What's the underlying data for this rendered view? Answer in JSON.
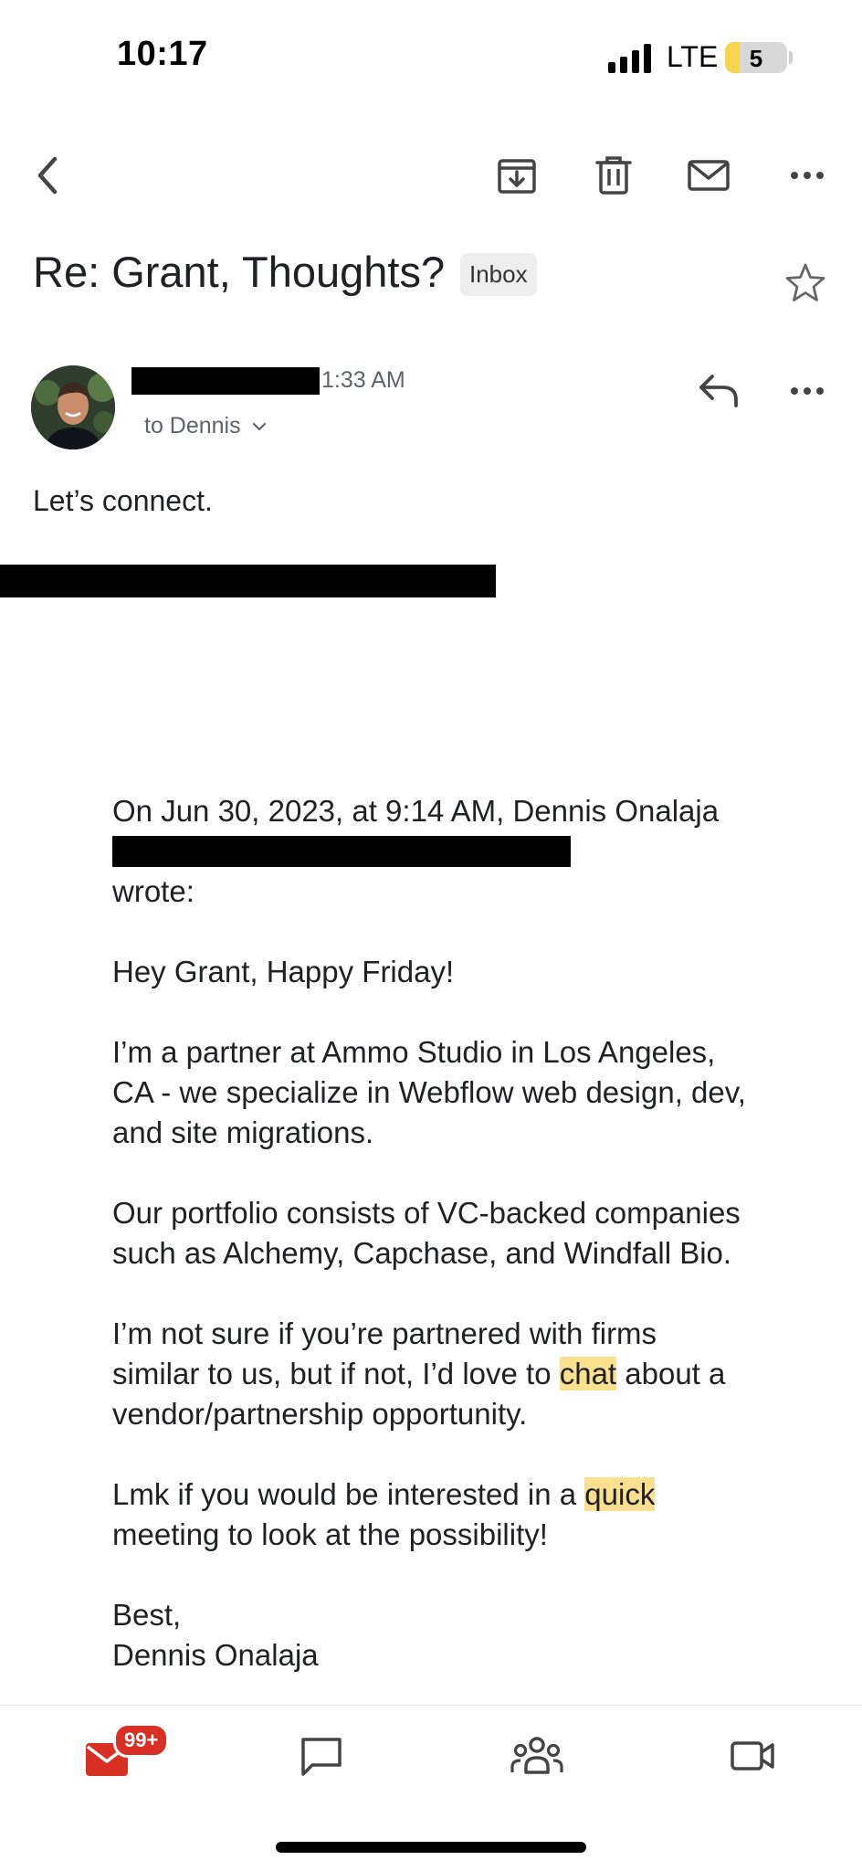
{
  "status_bar": {
    "time": "10:17",
    "network": "LTE",
    "battery": "5"
  },
  "toolbar": {
    "back_icon": "chevron-left-icon",
    "archive_icon": "archive-icon",
    "delete_icon": "trash-icon",
    "mark_unread_icon": "mail-icon",
    "more_icon": "more-horizontal-icon"
  },
  "email": {
    "subject": "Re: Grant, Thoughts?",
    "label": "Inbox",
    "sender": {
      "time": "1:33 AM",
      "recipients": "to Dennis"
    },
    "reply_text": "Let’s connect.",
    "quote": {
      "header_start": "On Jun 30, 2023, at 9:14 AM, Dennis Onalaja",
      "header_end": "wrote:",
      "greeting": "Hey Grant, Happy Friday!",
      "para1": "I’m a partner at Ammo Studio in Los Angeles, CA - we specialize in Webflow web design, dev, and site migrations.",
      "para2": "Our portfolio consists of VC-backed companies such as Alchemy, Capchase, and Windfall Bio.",
      "para3_before": "I’m not sure if you’re partnered with firms similar to us, but if not, I’d love to ",
      "para3_highlight": "chat",
      "para3_after": " about a vendor/partnership opportunity.",
      "para4_before": "Lmk if you would be interested in a ",
      "para4_highlight": "quick",
      "para4_after": " meeting to look at the possibility!",
      "signoff": "Best,",
      "signature": "Dennis Onalaja"
    }
  },
  "bottom_nav": {
    "mail_badge": "99+",
    "accent": "#d93025",
    "highlight": "#fbe08f"
  }
}
